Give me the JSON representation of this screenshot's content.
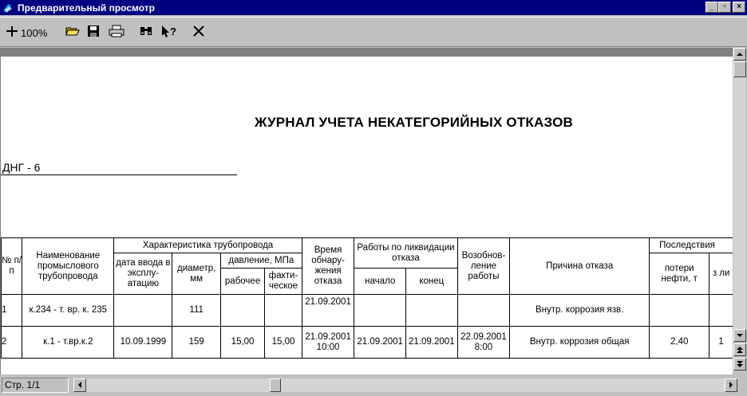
{
  "window": {
    "title": "Предварительный просмотр",
    "controls": {
      "minimize": "_",
      "restore": "▫",
      "close": "×"
    }
  },
  "toolbar": {
    "zoom_label": "100%",
    "icons": [
      "zoom-icon",
      "open-folder-icon",
      "save-icon",
      "print-icon",
      "find-icon",
      "help-pointer-icon",
      "close-icon"
    ]
  },
  "report": {
    "title": "ЖУРНАЛ УЧЕТА НЕКАТЕГОРИЙНЫХ ОТКАЗОВ",
    "department": "ДНГ - 6"
  },
  "table": {
    "headers": {
      "num": "№ п/п",
      "name": "Наименование промыслового трубопровода",
      "characteristics": "Характеристика трубопровода",
      "commission_date": "дата ввода в эксплу- атацию",
      "diameter": "диаметр, мм",
      "pressure": "давление, МПа",
      "pressure_work": "рабочее",
      "pressure_actual": "факти- ческое",
      "detect_time": "Время обнару- жения отказа",
      "repair": "Работы по ликвидации отказа",
      "repair_start": "начало",
      "repair_end": "конец",
      "resume": "Возобнов- ление работы",
      "cause": "Причина отказа",
      "consequences": "Последствия",
      "oil_loss": "потери нефти, т",
      "extra": "з ли"
    },
    "rows": [
      {
        "num": "1",
        "name": "к.234 - т. вр. к. 235",
        "commission_date": "",
        "diameter": "111",
        "pressure_work": "",
        "pressure_actual": "",
        "detect_time": "21.09.2001",
        "repair_start": "",
        "repair_end": "",
        "resume": "",
        "cause": "Внутр. коррозия язв.",
        "oil_loss": "",
        "extra": ""
      },
      {
        "num": "2",
        "name": "к.1 - т.вр.к.2",
        "commission_date": "10.09.1999",
        "diameter": "159",
        "pressure_work": "15,00",
        "pressure_actual": "15,00",
        "detect_time": "21.09.2001 10:00",
        "repair_start": "21.09.2001",
        "repair_end": "21.09.2001",
        "resume": "22.09.2001 8:00",
        "cause": "Внутр. коррозия общая",
        "oil_loss": "2,40",
        "extra": "1"
      }
    ]
  },
  "statusbar": {
    "page_indicator": "Стр. 1/1"
  }
}
